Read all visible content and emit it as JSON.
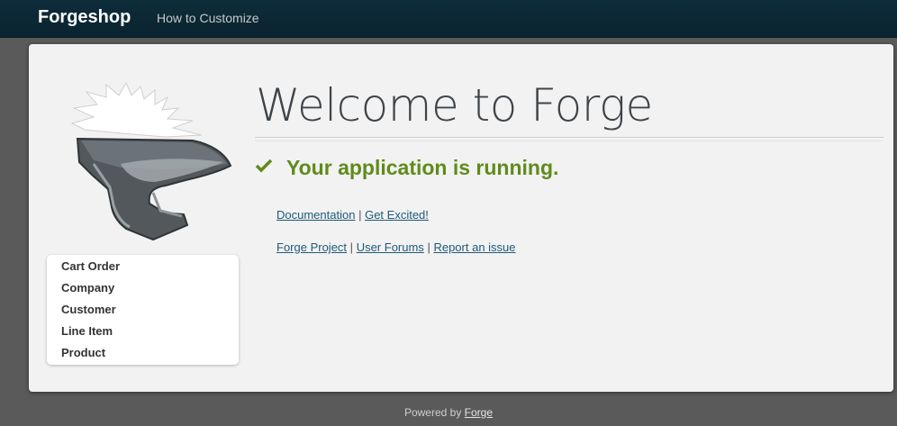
{
  "navbar": {
    "brand": "Forgeshop",
    "link": "How to Customize"
  },
  "sidebar": {
    "items": [
      "Cart Order",
      "Company",
      "Customer",
      "Line Item",
      "Product"
    ]
  },
  "main": {
    "title": "Welcome to Forge",
    "status": "Your application is running.",
    "links_row1": [
      "Documentation",
      "Get Excited!"
    ],
    "links_row2": [
      "Forge Project",
      "User Forums",
      "Report an issue"
    ],
    "separator": "|"
  },
  "footer": {
    "prefix": "Powered by",
    "link": "Forge"
  },
  "colors": {
    "navbar": "#0d2c3a",
    "accent_green": "#5f8b1b",
    "link": "#1f5a79"
  }
}
